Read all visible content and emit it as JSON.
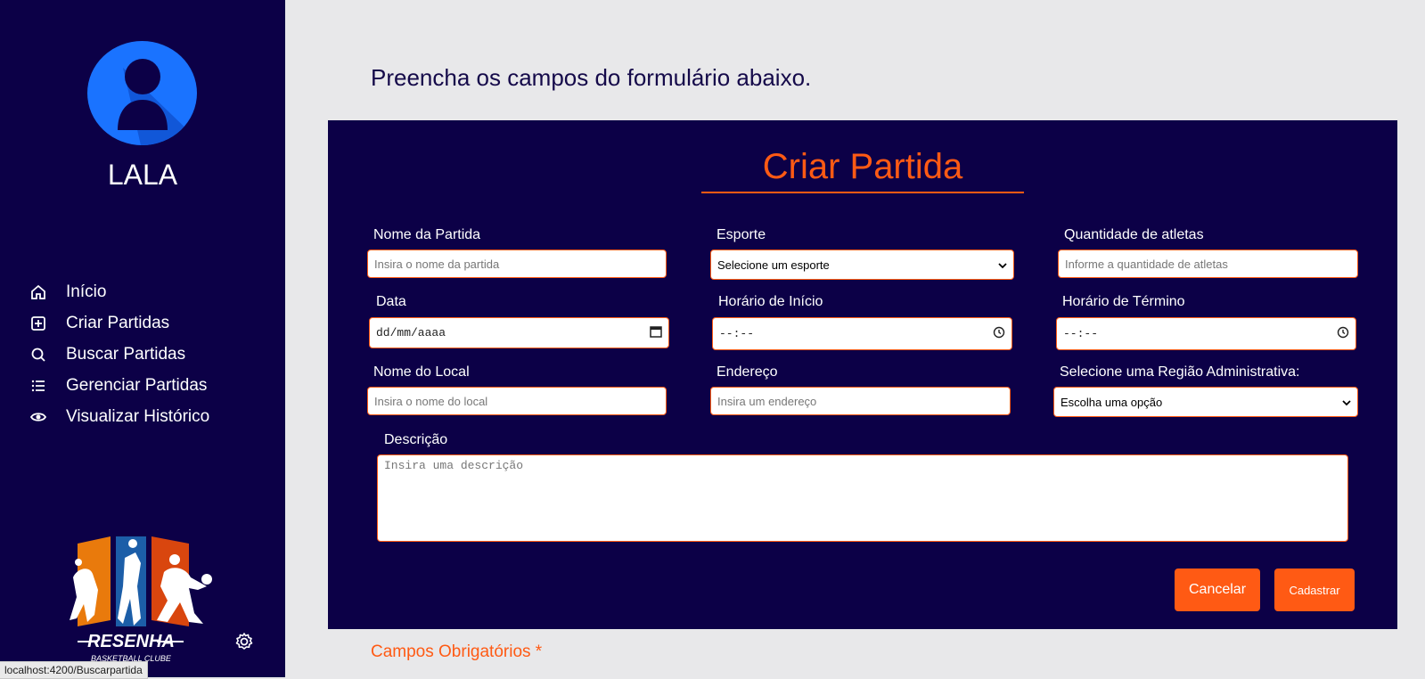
{
  "sidebar": {
    "username": "LALA",
    "nav": [
      {
        "label": "Início",
        "icon": "home-icon"
      },
      {
        "label": "Criar Partidas",
        "icon": "plus-square-icon"
      },
      {
        "label": "Buscar Partidas",
        "icon": "search-icon"
      },
      {
        "label": "Gerenciar Partidas",
        "icon": "list-icon"
      },
      {
        "label": "Visualizar Histórico",
        "icon": "eye-icon"
      }
    ],
    "logo_text": "RESENHA",
    "logo_subtext": "BASKETBALL CLUBE",
    "settings_icon": "gear-icon"
  },
  "status_url": "localhost:4200/Buscarpartida",
  "main": {
    "instructions": "Preencha os campos do formulário abaixo.",
    "form": {
      "title": "Criar Partida",
      "fields": {
        "nome_partida": {
          "label": "Nome da Partida",
          "placeholder": "Insira o nome da partida"
        },
        "esporte": {
          "label": "Esporte",
          "value": "Selecione um esporte"
        },
        "quantidade": {
          "label": "Quantidade de atletas",
          "placeholder": "Informe a quantidade de atletas"
        },
        "data": {
          "label": "Data",
          "value": "dd/mm/aaaa"
        },
        "horario_inicio": {
          "label": "Horário de Início",
          "value": "--:--"
        },
        "horario_termino": {
          "label": "Horário de Término",
          "value": "--:--"
        },
        "nome_local": {
          "label": "Nome do Local",
          "placeholder": "Insira o nome do local"
        },
        "endereco": {
          "label": "Endereço",
          "placeholder": "Insira um endereço"
        },
        "regiao": {
          "label": "Selecione uma Região Administrativa:",
          "value": "Escolha uma opção"
        },
        "descricao": {
          "label": "Descrição",
          "placeholder": "Insira uma descrição"
        }
      },
      "buttons": {
        "cancel": "Cancelar",
        "submit": "Cadastrar"
      }
    },
    "required_note": "Campos Obrigatórios *"
  },
  "colors": {
    "sidebar_bg": "#0c0047",
    "accent": "#ff5a14",
    "page_bg": "#e8e8ea",
    "avatar_bg": "#1a73ff"
  }
}
